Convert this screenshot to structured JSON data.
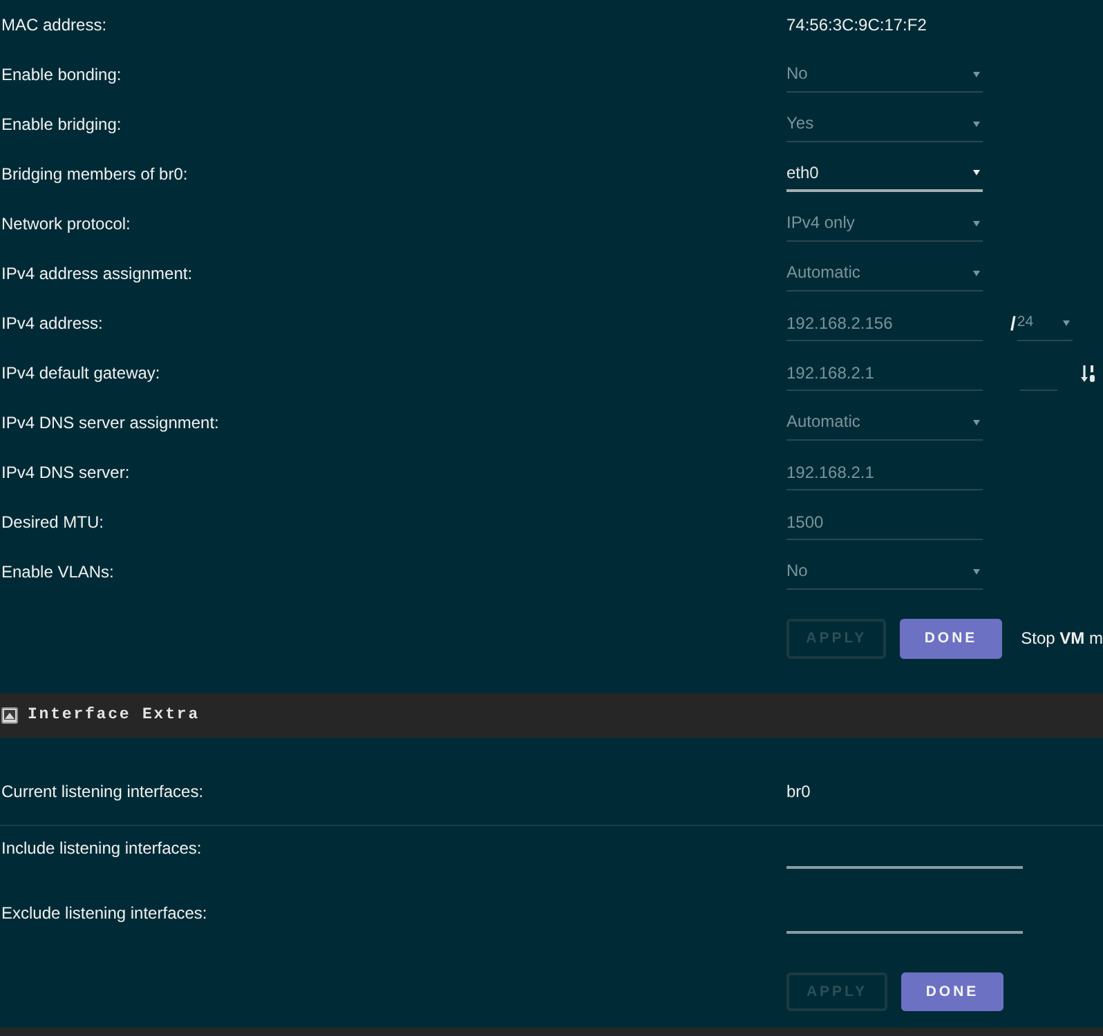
{
  "interface": {
    "rows": [
      {
        "kind": "text",
        "label": "MAC address:",
        "value": "74:56:3C:9C:17:F2"
      },
      {
        "kind": "select",
        "label": "Enable bonding:",
        "value": "No",
        "disabled": true
      },
      {
        "kind": "select",
        "label": "Enable bridging:",
        "value": "Yes",
        "disabled": true
      },
      {
        "kind": "select",
        "label": "Bridging members of br0:",
        "value": "eth0",
        "disabled": false
      },
      {
        "kind": "select",
        "label": "Network protocol:",
        "value": "IPv4 only",
        "disabled": true
      },
      {
        "kind": "select",
        "label": "IPv4 address assignment:",
        "value": "Automatic",
        "disabled": true
      },
      {
        "kind": "input",
        "label": "IPv4 address:",
        "value": "192.168.2.156",
        "disabled": true,
        "netmask": {
          "separator": "/",
          "value": "24",
          "disabled": true
        }
      },
      {
        "kind": "input",
        "label": "IPv4 default gateway:",
        "value": "192.168.2.1",
        "disabled": true,
        "metric": {
          "disabled": true
        }
      },
      {
        "kind": "select",
        "label": "IPv4 DNS server assignment:",
        "value": "Automatic",
        "disabled": true
      },
      {
        "kind": "input",
        "label": "IPv4 DNS server:",
        "value": "192.168.2.1",
        "disabled": true
      },
      {
        "kind": "input",
        "label": "Desired MTU:",
        "value": "1500",
        "disabled": true
      },
      {
        "kind": "select",
        "label": "Enable VLANs:",
        "value": "No",
        "disabled": true
      }
    ],
    "buttons": [
      {
        "kind": "outline",
        "label": "APPLY",
        "disabled": true
      },
      {
        "kind": "primary",
        "label": "DONE",
        "disabled": false
      }
    ],
    "note": "Stop **VM** m"
  },
  "interface_extra": {
    "title": "Interface Extra",
    "rows": [
      {
        "kind": "text",
        "label": "Current listening interfaces:",
        "value": "br0"
      },
      {
        "kind": "input",
        "label": "Include listening interfaces:",
        "disabled": false
      },
      {
        "kind": "input",
        "label": "Exclude listening interfaces:",
        "disabled": false
      }
    ],
    "buttons": [
      {
        "kind": "outline",
        "label": "APPLY",
        "disabled": true
      },
      {
        "kind": "primary",
        "label": "DONE",
        "disabled": false
      }
    ]
  }
}
